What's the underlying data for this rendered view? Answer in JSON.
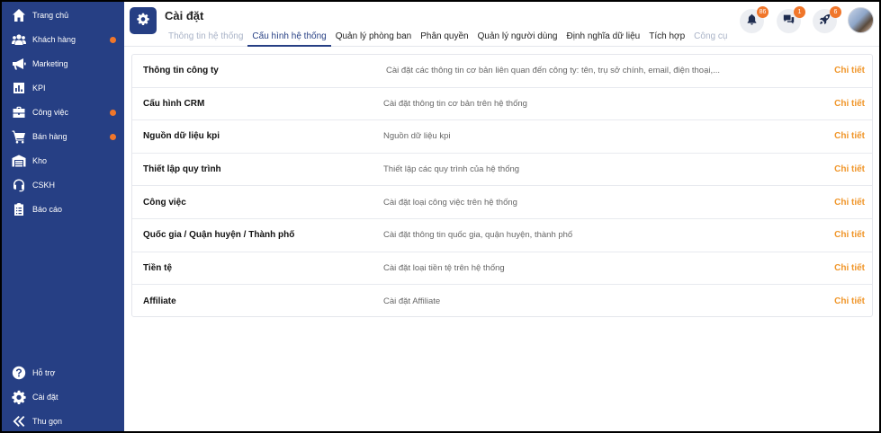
{
  "sidebar": {
    "items": [
      {
        "label": "Trang chủ",
        "icon": "home-icon",
        "dot": false
      },
      {
        "label": "Khách hàng",
        "icon": "users-icon",
        "dot": true
      },
      {
        "label": "Marketing",
        "icon": "megaphone-icon",
        "dot": false
      },
      {
        "label": "KPI",
        "icon": "chart-icon",
        "dot": false
      },
      {
        "label": "Công việc",
        "icon": "briefcase-icon",
        "dot": true
      },
      {
        "label": "Bán hàng",
        "icon": "cart-icon",
        "dot": true
      },
      {
        "label": "Kho",
        "icon": "warehouse-icon",
        "dot": false
      },
      {
        "label": "CSKH",
        "icon": "headset-icon",
        "dot": false
      },
      {
        "label": "Báo cáo",
        "icon": "clipboard-icon",
        "dot": false
      }
    ],
    "bottom": [
      {
        "label": "Hỗ trợ",
        "icon": "help-icon"
      },
      {
        "label": "Cài đặt",
        "icon": "gear-icon"
      },
      {
        "label": "Thu gọn",
        "icon": "collapse-icon"
      }
    ],
    "dot_color": "#f0762a",
    "bg_color": "#263f84"
  },
  "header": {
    "title": "Cài đặt",
    "tabs": [
      {
        "label": "Thông tin hệ thống",
        "state": "muted"
      },
      {
        "label": "Cấu hình hệ thống",
        "state": "active"
      },
      {
        "label": "Quản lý phòng ban",
        "state": "normal"
      },
      {
        "label": "Phân quyền",
        "state": "normal"
      },
      {
        "label": "Quản lý người dùng",
        "state": "normal"
      },
      {
        "label": "Định nghĩa dữ liệu",
        "state": "normal"
      },
      {
        "label": "Tích hợp",
        "state": "normal"
      },
      {
        "label": "Công cụ",
        "state": "muted"
      }
    ],
    "notifications": {
      "bell": "86",
      "chat": "1",
      "rocket": "6"
    }
  },
  "settings_rows": [
    {
      "name": "Thông tin công ty",
      "desc": "Cài đặt các thông tin cơ bản liên quan đến công ty: tên, trụ sở chính, email, điện thoại,...",
      "link": "Chi tiết"
    },
    {
      "name": "Cấu hình CRM",
      "desc": "Cài đặt thông tin cơ bản trên hệ thống",
      "link": "Chi tiết"
    },
    {
      "name": "Nguồn dữ liệu kpi",
      "desc": "Nguồn dữ liệu kpi",
      "link": "Chi tiết"
    },
    {
      "name": "Thiết lập quy trình",
      "desc": "Thiết lập các quy trình của hệ thống",
      "link": "Chi tiết"
    },
    {
      "name": "Công việc",
      "desc": "Cài đặt loại công việc trên hệ thống",
      "link": "Chi tiết"
    },
    {
      "name": "Quốc gia / Quận huyện / Thành phố",
      "desc": "Cài đặt thông tin quốc gia, quận huyện, thành phố",
      "link": "Chi tiết"
    },
    {
      "name": "Tiền tệ",
      "desc": "Cài đặt loại tiền tệ trên hệ thống",
      "link": "Chi tiết"
    },
    {
      "name": "Affiliate",
      "desc": "Cài đặt Affiliate",
      "link": "Chi tiết"
    }
  ]
}
